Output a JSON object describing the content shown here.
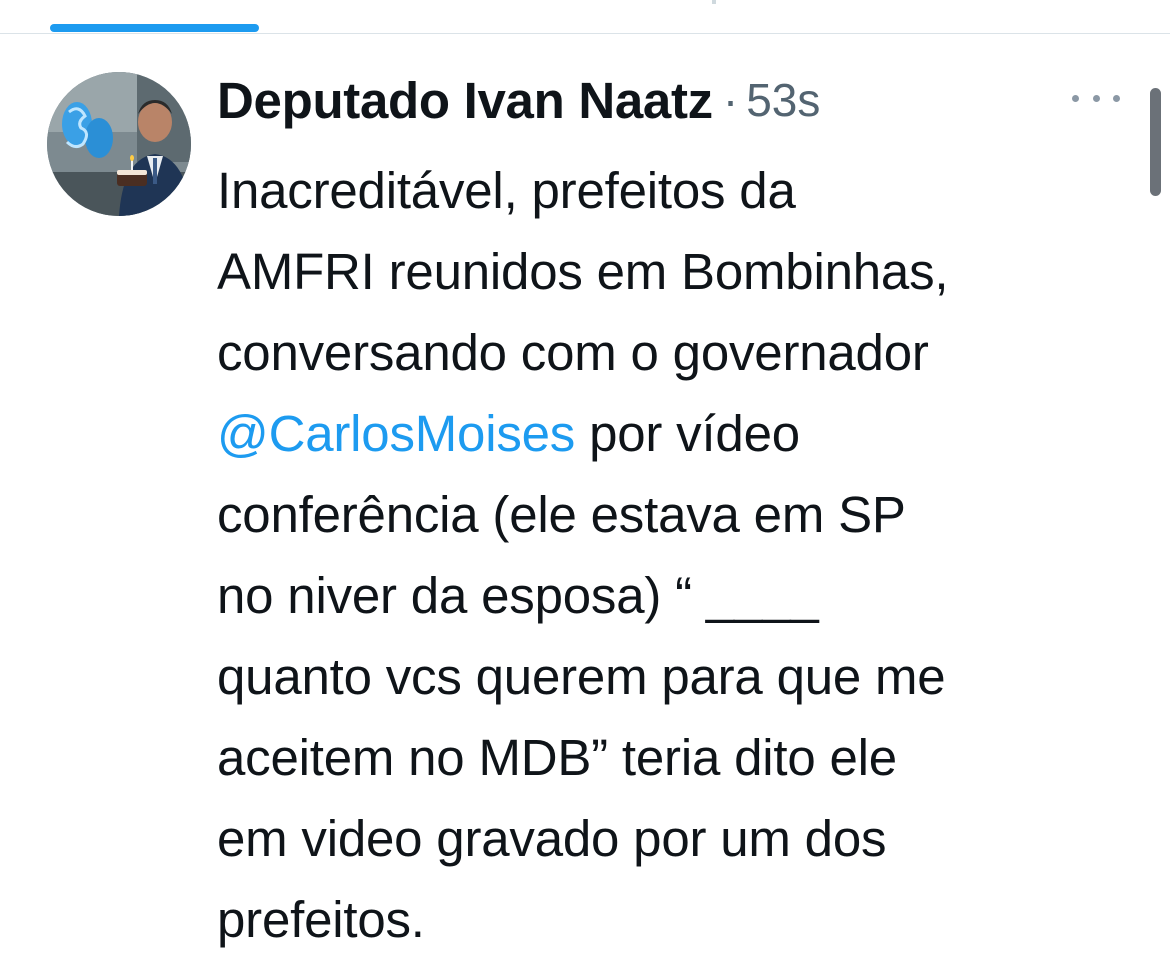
{
  "tabs": {
    "active_indicator_color": "#1d9bf0"
  },
  "tweet": {
    "author": {
      "display_name": "Deputado Ivan Naatz",
      "avatar_icon": "profile-photo"
    },
    "separator": "·",
    "timestamp": "53s",
    "more_icon": "more-horizontal-icon",
    "text_lines": [
      {
        "pre": "Inacreditável, prefeitos da"
      },
      {
        "pre": "AMFRI reunidos em Bombinhas,"
      },
      {
        "pre": "conversando com o governador"
      },
      {
        "mention": "@CarlosMoises",
        "post": " por vídeo"
      },
      {
        "pre": "conferência (ele estava em SP"
      },
      {
        "pre": "no niver da esposa) “ ____"
      },
      {
        "pre": "quanto vcs querem para que me"
      },
      {
        "pre": "aceitem no MDB” teria dito ele"
      },
      {
        "pre": "em video gravado por um dos"
      },
      {
        "pre": "prefeitos."
      }
    ]
  },
  "colors": {
    "text": "#0f1419",
    "secondary": "#536471",
    "link": "#1d9bf0"
  }
}
